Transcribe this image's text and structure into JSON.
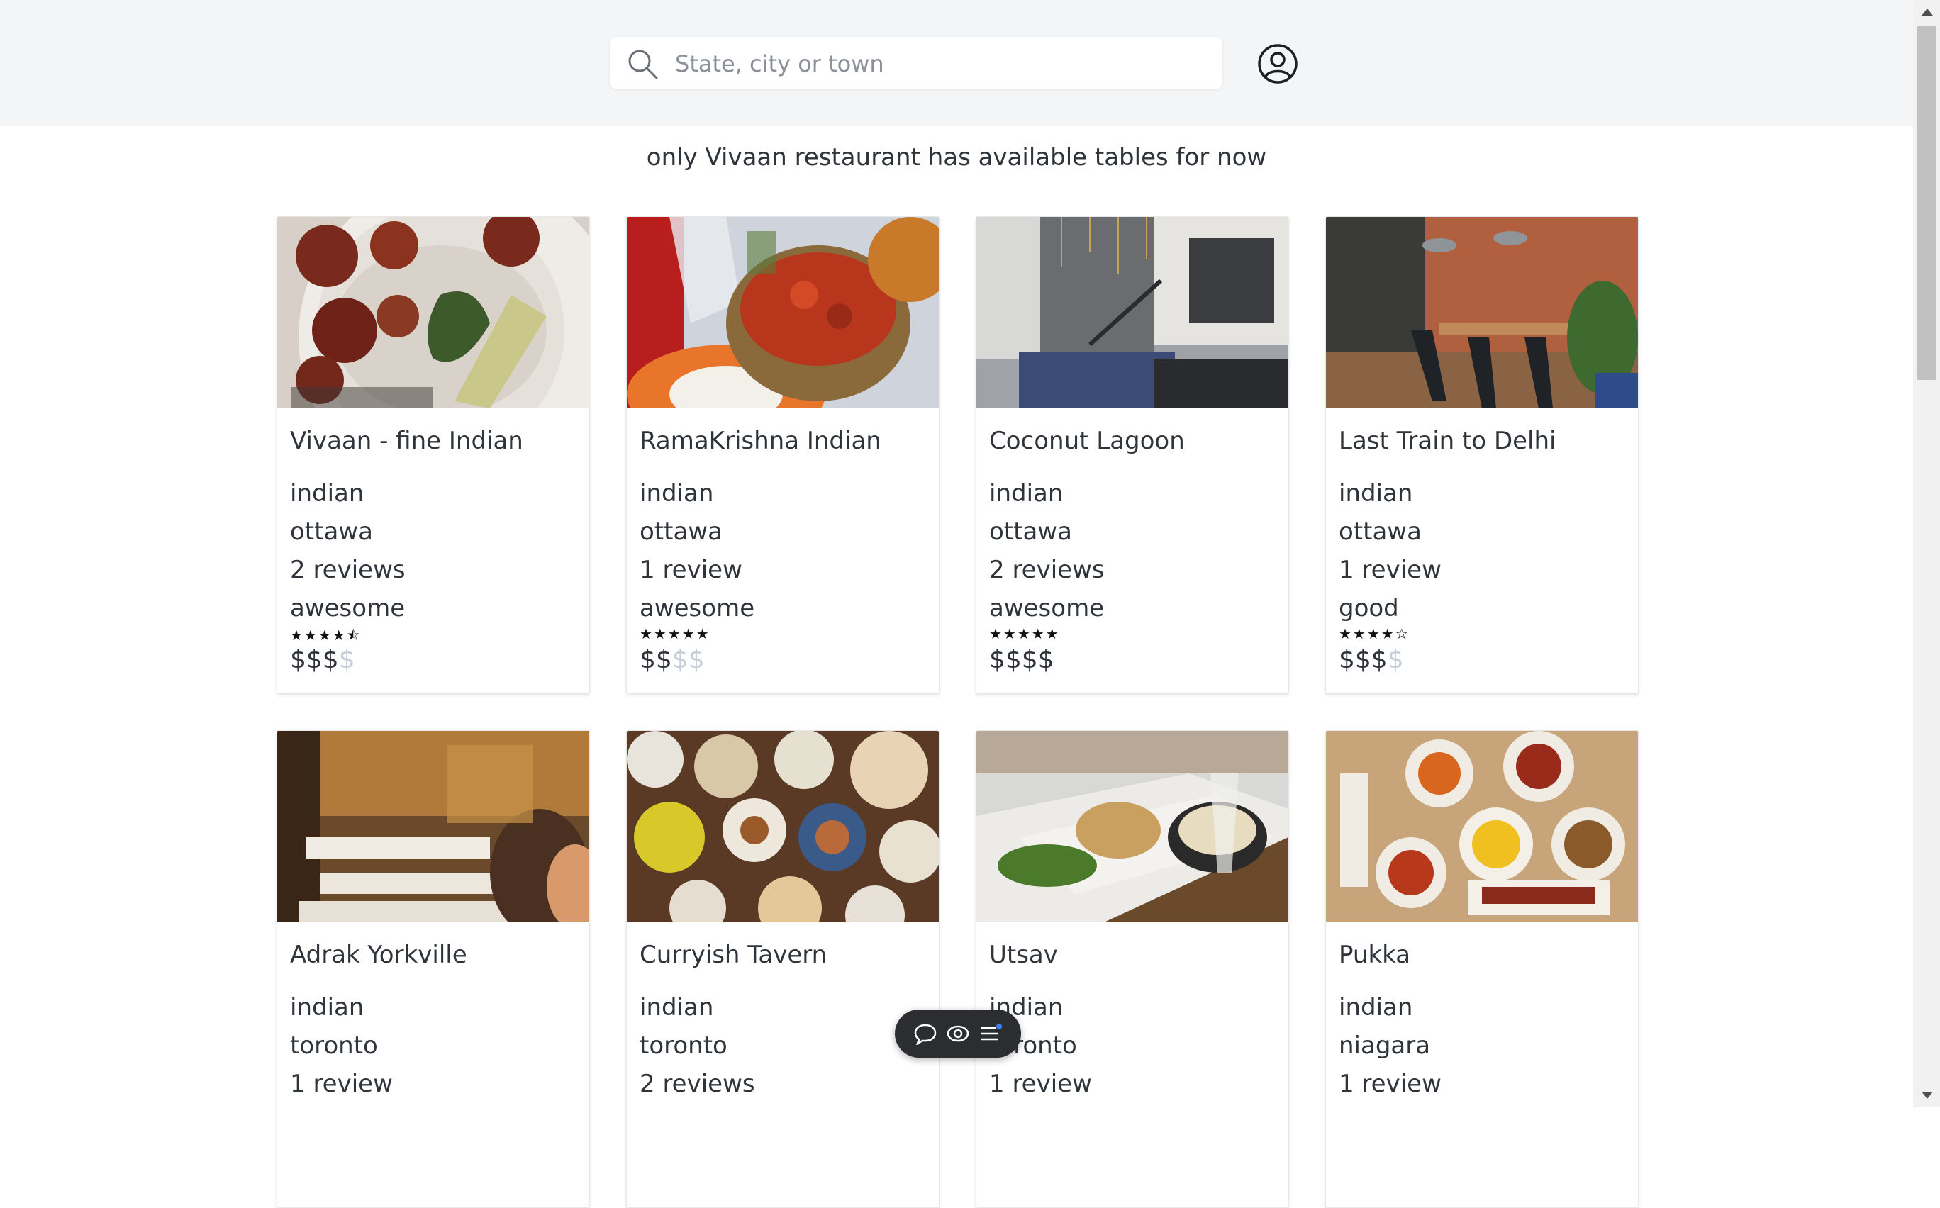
{
  "search": {
    "placeholder": "State, city or town"
  },
  "notice": "only Vivaan restaurant has available tables for now",
  "colors": {
    "header_bg": "#f4f5f7",
    "price_inactive": "#c8ced8",
    "toolbar_bg": "#2b2d30"
  },
  "icons": {
    "search": "search-icon",
    "profile": "user-circle-icon",
    "toolbar": [
      "chat-bubble-icon",
      "eye-icon",
      "list-icon"
    ]
  },
  "restaurants": [
    {
      "name": "Vivaan - fine Indian",
      "cuisine": "indian",
      "city": "ottawa",
      "reviews": "2 reviews",
      "rating_text": "awesome",
      "stars": "★★★★⯪",
      "rating": 4.5,
      "price_on": "$$$",
      "price_off": "$",
      "price_level": 3
    },
    {
      "name": "RamaKrishna Indian",
      "cuisine": "indian",
      "city": "ottawa",
      "reviews": "1 review",
      "rating_text": "awesome",
      "stars": "★★★★★",
      "rating": 5,
      "price_on": "$$",
      "price_off": "$$",
      "price_level": 2
    },
    {
      "name": "Coconut Lagoon",
      "cuisine": "indian",
      "city": "ottawa",
      "reviews": "2 reviews",
      "rating_text": "awesome",
      "stars": "★★★★★",
      "rating": 5,
      "price_on": "$$$$",
      "price_off": "",
      "price_level": 4
    },
    {
      "name": "Last Train to Delhi",
      "cuisine": "indian",
      "city": "ottawa",
      "reviews": "1 review",
      "rating_text": "good",
      "stars": "★★★★☆",
      "rating": 4,
      "price_on": "$$$",
      "price_off": "$",
      "price_level": 3
    },
    {
      "name": "Adrak Yorkville",
      "cuisine": "indian",
      "city": "toronto",
      "reviews": "1 review"
    },
    {
      "name": "Curryish Tavern",
      "cuisine": "indian",
      "city": "toronto",
      "reviews": "2 reviews"
    },
    {
      "name": "Utsav",
      "cuisine": "indian",
      "city": "toronto",
      "reviews": "1 review"
    },
    {
      "name": "Pukka",
      "cuisine": "indian",
      "city": "niagara",
      "reviews": "1 review"
    }
  ]
}
